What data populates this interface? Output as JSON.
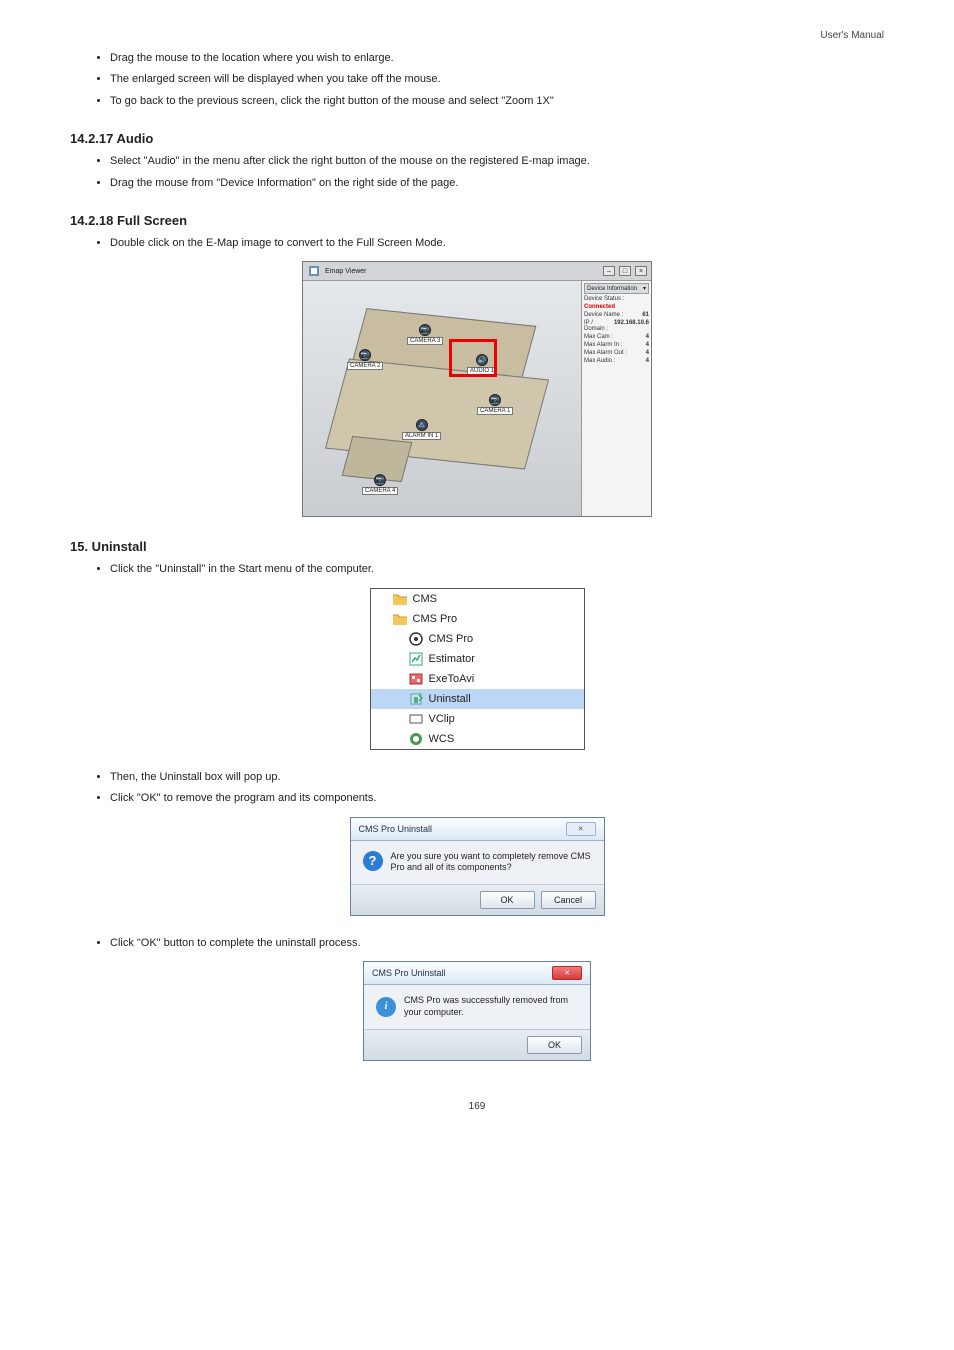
{
  "header": {
    "text": "User's Manual"
  },
  "bullets_top": [
    "Drag the mouse to the location where you wish to enlarge.",
    "The enlarged screen will be displayed when you take off the mouse.",
    "To go back to the previous screen, click the right button of the mouse and select \"Zoom 1X\""
  ],
  "section_audio": {
    "title": "14.2.17 Audio",
    "bullets": [
      "Select \"Audio\" in the menu after click the right button of the mouse on the registered E-map image.",
      "Drag the mouse from \"Device Information\" on the right side of the page."
    ]
  },
  "section_fullscreen": {
    "title": "14.2.18 Full Screen",
    "bullet": "Double click on the E-Map image to convert to the Full Screen Mode."
  },
  "emap": {
    "title": "Emap Viewer",
    "side_tab": "Device Information",
    "markers": {
      "cam2": "CAMERA 2",
      "cam3": "CAMERA 3",
      "cam1": "CAMERA 1",
      "cam4": "CAMERA 4",
      "alarm": "ALARM IN 1",
      "audio": "AUDIO 1"
    },
    "info": {
      "status_k": "Device Status :",
      "status_v": "Connected",
      "name_k": "Device Name :",
      "name_v": "61",
      "ip_k": "IP / Domain :",
      "ip_v": "192.168.10.6",
      "cam_k": "Max Cam :",
      "cam_v": "4",
      "ain_k": "Max Alarm In :",
      "ain_v": "4",
      "aout_k": "Max Alarm Out :",
      "aout_v": "4",
      "aud_k": "Max Audio :",
      "aud_v": "4"
    }
  },
  "ch15": {
    "title": "15. Uninstall",
    "b1": "Click the \"Uninstall\" in the Start menu of the computer.",
    "b2": "Then, the Uninstall box will pop up.",
    "b3": "Click \"OK\" to remove the program and its components.",
    "b4": "Click \"OK\" button to complete the uninstall process."
  },
  "menu": {
    "items": {
      "cms": "CMS",
      "cmspro_folder": "CMS Pro",
      "cmspro": "CMS Pro",
      "estimator": "Estimator",
      "exetoavi": "ExeToAvi",
      "uninstall": "Uninstall",
      "vclip": "VClip",
      "wcs": "WCS"
    }
  },
  "dlg1": {
    "title": "CMS Pro Uninstall",
    "msg": "Are you sure you want to completely remove CMS Pro and all of its components?",
    "ok": "OK",
    "cancel": "Cancel"
  },
  "dlg2": {
    "title": "CMS Pro Uninstall",
    "msg": "CMS Pro was successfully removed from your computer.",
    "ok": "OK"
  },
  "page_number": "169"
}
